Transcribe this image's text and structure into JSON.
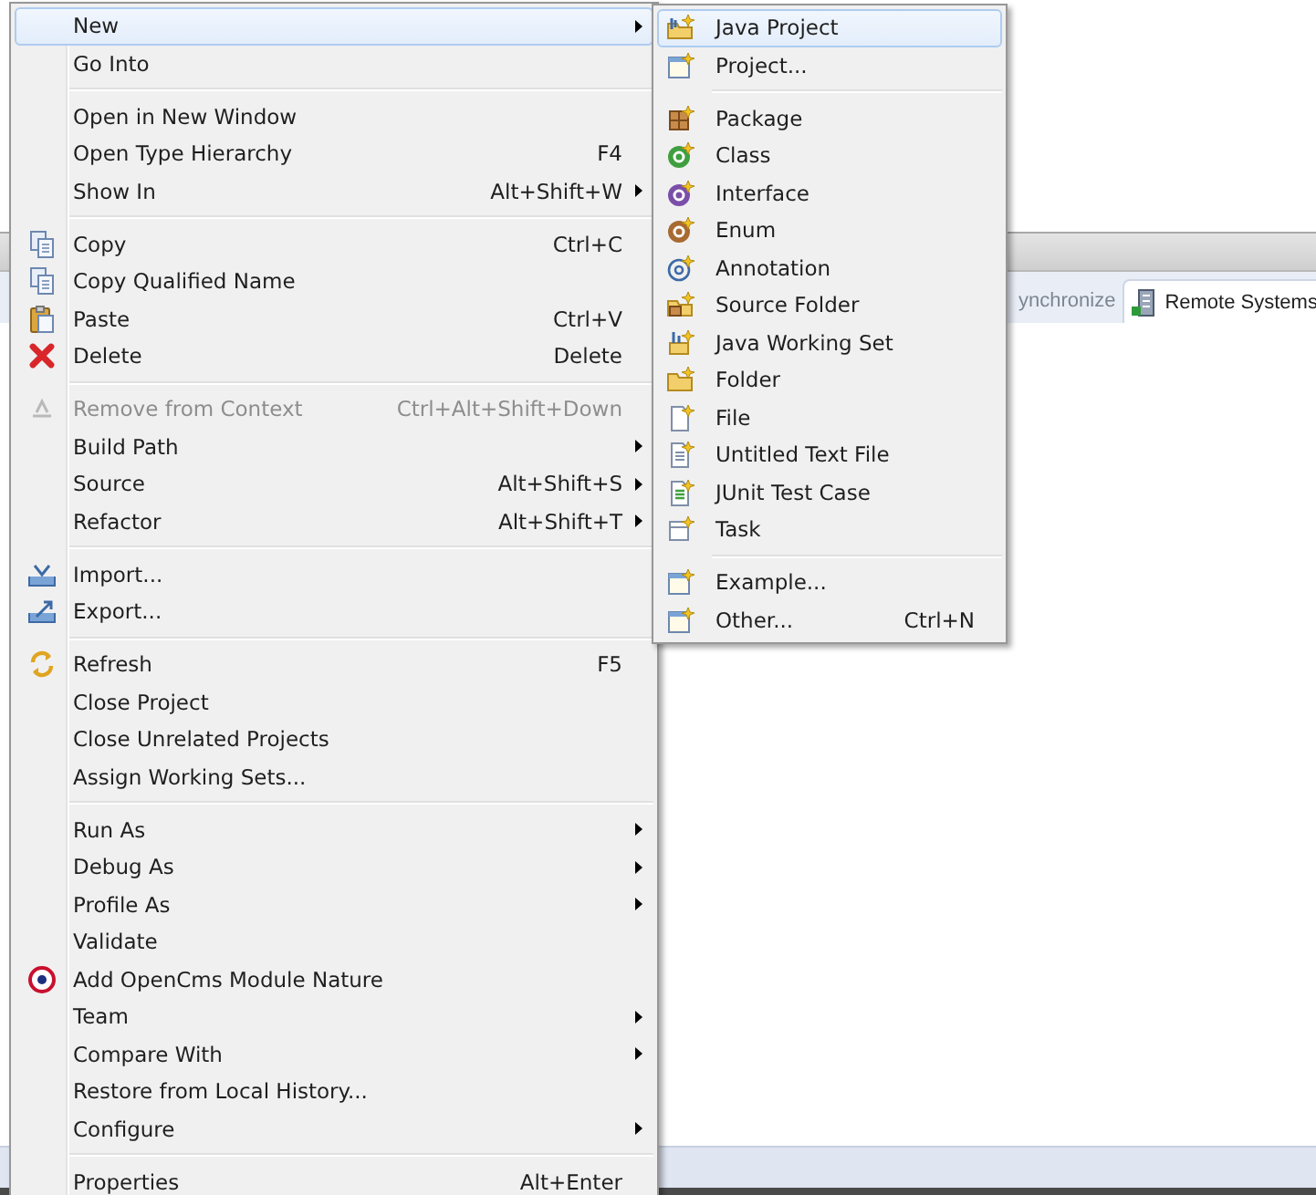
{
  "view_tabs": [
    {
      "label": "ynchronize",
      "selected": false
    },
    {
      "label": "Remote Systems",
      "selected": true
    }
  ],
  "context_menu": {
    "sections": [
      {
        "items": [
          {
            "label": "New",
            "has_submenu": true,
            "disabled": false,
            "selected": true
          },
          {
            "label": "Go Into",
            "has_submenu": false,
            "disabled": false,
            "selected": false
          }
        ]
      },
      {
        "items": [
          {
            "label": "Open in New Window",
            "has_submenu": false,
            "disabled": false,
            "selected": false
          },
          {
            "label": "Open Type Hierarchy",
            "shortcut": "F4",
            "has_submenu": false,
            "disabled": false,
            "selected": false
          },
          {
            "label": "Show In",
            "shortcut": "Alt+Shift+W",
            "has_submenu": true,
            "disabled": false,
            "selected": false
          }
        ]
      },
      {
        "items": [
          {
            "label": "Copy",
            "shortcut": "Ctrl+C",
            "has_submenu": false,
            "disabled": false,
            "selected": false
          },
          {
            "label": "Copy Qualified Name",
            "has_submenu": false,
            "disabled": false,
            "selected": false
          },
          {
            "label": "Paste",
            "shortcut": "Ctrl+V",
            "has_submenu": false,
            "disabled": false,
            "selected": false
          },
          {
            "label": "Delete",
            "shortcut": "Delete",
            "has_submenu": false,
            "disabled": false,
            "selected": false
          }
        ]
      },
      {
        "items": [
          {
            "label": "Remove from Context",
            "shortcut": "Ctrl+Alt+Shift+Down",
            "has_submenu": false,
            "disabled": true,
            "selected": false
          },
          {
            "label": "Build Path",
            "has_submenu": true,
            "disabled": false,
            "selected": false
          },
          {
            "label": "Source",
            "shortcut": "Alt+Shift+S",
            "has_submenu": true,
            "disabled": false,
            "selected": false
          },
          {
            "label": "Refactor",
            "shortcut": "Alt+Shift+T",
            "has_submenu": true,
            "disabled": false,
            "selected": false
          }
        ]
      },
      {
        "items": [
          {
            "label": "Import...",
            "has_submenu": false,
            "disabled": false,
            "selected": false
          },
          {
            "label": "Export...",
            "has_submenu": false,
            "disabled": false,
            "selected": false
          }
        ]
      },
      {
        "items": [
          {
            "label": "Refresh",
            "shortcut": "F5",
            "has_submenu": false,
            "disabled": false,
            "selected": false
          },
          {
            "label": "Close Project",
            "has_submenu": false,
            "disabled": false,
            "selected": false
          },
          {
            "label": "Close Unrelated Projects",
            "has_submenu": false,
            "disabled": false,
            "selected": false
          },
          {
            "label": "Assign Working Sets...",
            "has_submenu": false,
            "disabled": false,
            "selected": false
          }
        ]
      },
      {
        "items": [
          {
            "label": "Run As",
            "has_submenu": true,
            "disabled": false,
            "selected": false
          },
          {
            "label": "Debug As",
            "has_submenu": true,
            "disabled": false,
            "selected": false
          },
          {
            "label": "Profile As",
            "has_submenu": true,
            "disabled": false,
            "selected": false
          },
          {
            "label": "Validate",
            "has_submenu": false,
            "disabled": false,
            "selected": false
          },
          {
            "label": "Add OpenCms Module Nature",
            "has_submenu": false,
            "disabled": false,
            "selected": false
          },
          {
            "label": "Team",
            "has_submenu": true,
            "disabled": false,
            "selected": false
          },
          {
            "label": "Compare With",
            "has_submenu": true,
            "disabled": false,
            "selected": false
          },
          {
            "label": "Restore from Local History...",
            "has_submenu": false,
            "disabled": false,
            "selected": false
          },
          {
            "label": "Configure",
            "has_submenu": true,
            "disabled": false,
            "selected": false
          }
        ]
      },
      {
        "items": [
          {
            "label": "Properties",
            "shortcut": "Alt+Enter",
            "has_submenu": false,
            "disabled": false,
            "selected": false
          }
        ]
      }
    ]
  },
  "new_submenu": {
    "sections": [
      {
        "items": [
          {
            "label": "Java Project",
            "selected": true
          },
          {
            "label": "Project...",
            "selected": false
          }
        ]
      },
      {
        "items": [
          {
            "label": "Package",
            "selected": false
          },
          {
            "label": "Class",
            "selected": false
          },
          {
            "label": "Interface",
            "selected": false
          },
          {
            "label": "Enum",
            "selected": false
          },
          {
            "label": "Annotation",
            "selected": false
          },
          {
            "label": "Source Folder",
            "selected": false
          },
          {
            "label": "Java Working Set",
            "selected": false
          },
          {
            "label": "Folder",
            "selected": false
          },
          {
            "label": "File",
            "selected": false
          },
          {
            "label": "Untitled Text File",
            "selected": false
          },
          {
            "label": "JUnit Test Case",
            "selected": false
          },
          {
            "label": "Task",
            "selected": false
          }
        ]
      },
      {
        "items": [
          {
            "label": "Example...",
            "selected": false
          },
          {
            "label": "Other...",
            "shortcut": "Ctrl+N",
            "selected": false
          }
        ]
      }
    ]
  }
}
